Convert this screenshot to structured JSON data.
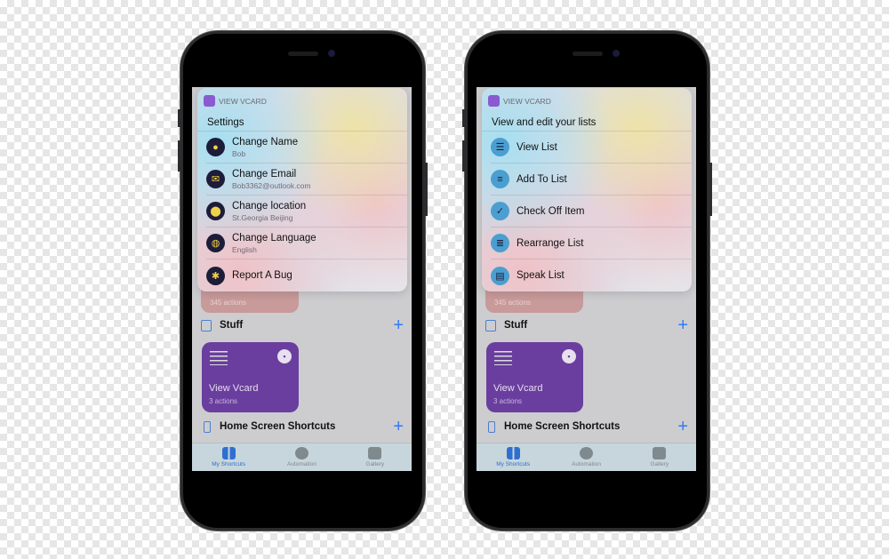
{
  "colors": {
    "accent": "#3478f6",
    "card": "#6a3e9e",
    "icon_dark": "#1d1d3a",
    "icon_yellow": "#f0d24a",
    "icon_blue": "#4a9fd0"
  },
  "phones": [
    {
      "app_name": "VIEW VCARD",
      "menu_title": "Settings",
      "icon_style": "dark",
      "items": [
        {
          "label": "Change Name",
          "sub": "Bob",
          "icon": "person-icon"
        },
        {
          "label": "Change Email",
          "sub": "Bob3362@outlook.com",
          "icon": "envelope-icon"
        },
        {
          "label": "Change location",
          "sub": "St.Georgia Beijing",
          "icon": "location-pin-icon"
        },
        {
          "label": "Change Language",
          "sub": "English",
          "icon": "globe-icon"
        },
        {
          "label": "Report A Bug",
          "sub": "",
          "icon": "bug-icon"
        }
      ]
    },
    {
      "app_name": "VIEW VCARD",
      "menu_title": "View and edit your lists",
      "icon_style": "blue",
      "items": [
        {
          "label": "View List",
          "sub": "",
          "icon": "list-icon"
        },
        {
          "label": "Add To List",
          "sub": "",
          "icon": "list-add-icon"
        },
        {
          "label": "Check Off Item",
          "sub": "",
          "icon": "checklist-icon"
        },
        {
          "label": "Rearrange List",
          "sub": "",
          "icon": "reorder-icon"
        },
        {
          "label": "Speak List",
          "sub": "",
          "icon": "speech-bubble-icon"
        }
      ]
    }
  ],
  "home": {
    "pink_card_sub": "345 actions",
    "folder_label": "Stuff",
    "shortcut": {
      "title": "View Vcard",
      "sub": "3 actions"
    },
    "home_screen_label": "Home Screen Shortcuts",
    "tabs": [
      {
        "label": "My Shortcuts",
        "active": true
      },
      {
        "label": "Automation",
        "active": false
      },
      {
        "label": "Gallery",
        "active": false
      }
    ]
  }
}
